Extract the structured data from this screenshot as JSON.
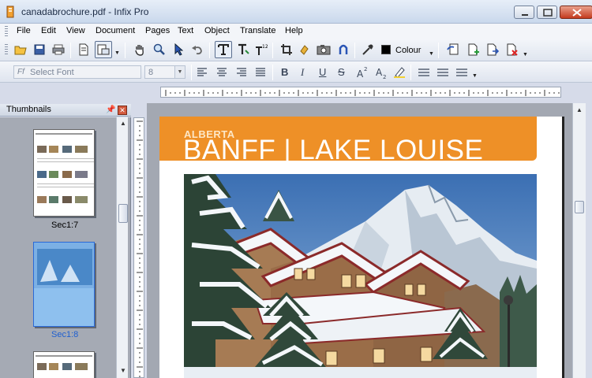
{
  "window": {
    "title": "canadabrochure.pdf - Infix Pro"
  },
  "menu": [
    "File",
    "Edit",
    "View",
    "Document",
    "Pages",
    "Text",
    "Object",
    "Translate",
    "Help"
  ],
  "toolbar": {
    "colour_label": "Colour",
    "font_placeholder": "Select Font",
    "font_icon_text": "Ff",
    "font_size": "8"
  },
  "thumbnails": {
    "title": "Thumbnails",
    "pages": [
      {
        "label": "Sec1:7",
        "selected": false
      },
      {
        "label": "Sec1:8",
        "selected": true
      },
      {
        "label": "",
        "selected": false
      }
    ]
  },
  "document": {
    "banner_sub": "ALBERTA",
    "banner_main": "BANFF | LAKE LOUISE",
    "banner_color": "#ee9027"
  },
  "icons": [
    "open-folder-icon",
    "save-icon",
    "print-icon",
    "page-icon",
    "page-layout-icon",
    "hand-icon",
    "zoom-icon",
    "select-arrow-icon",
    "undo-icon",
    "text-tool-icon",
    "text-edit-icon",
    "text-number-icon",
    "crop-icon",
    "link-icon",
    "camera-icon",
    "magnet-icon",
    "eyedropper-icon",
    "colour-swatch-icon",
    "replace-page-icon",
    "add-page-icon",
    "extract-page-icon",
    "delete-page-icon"
  ]
}
